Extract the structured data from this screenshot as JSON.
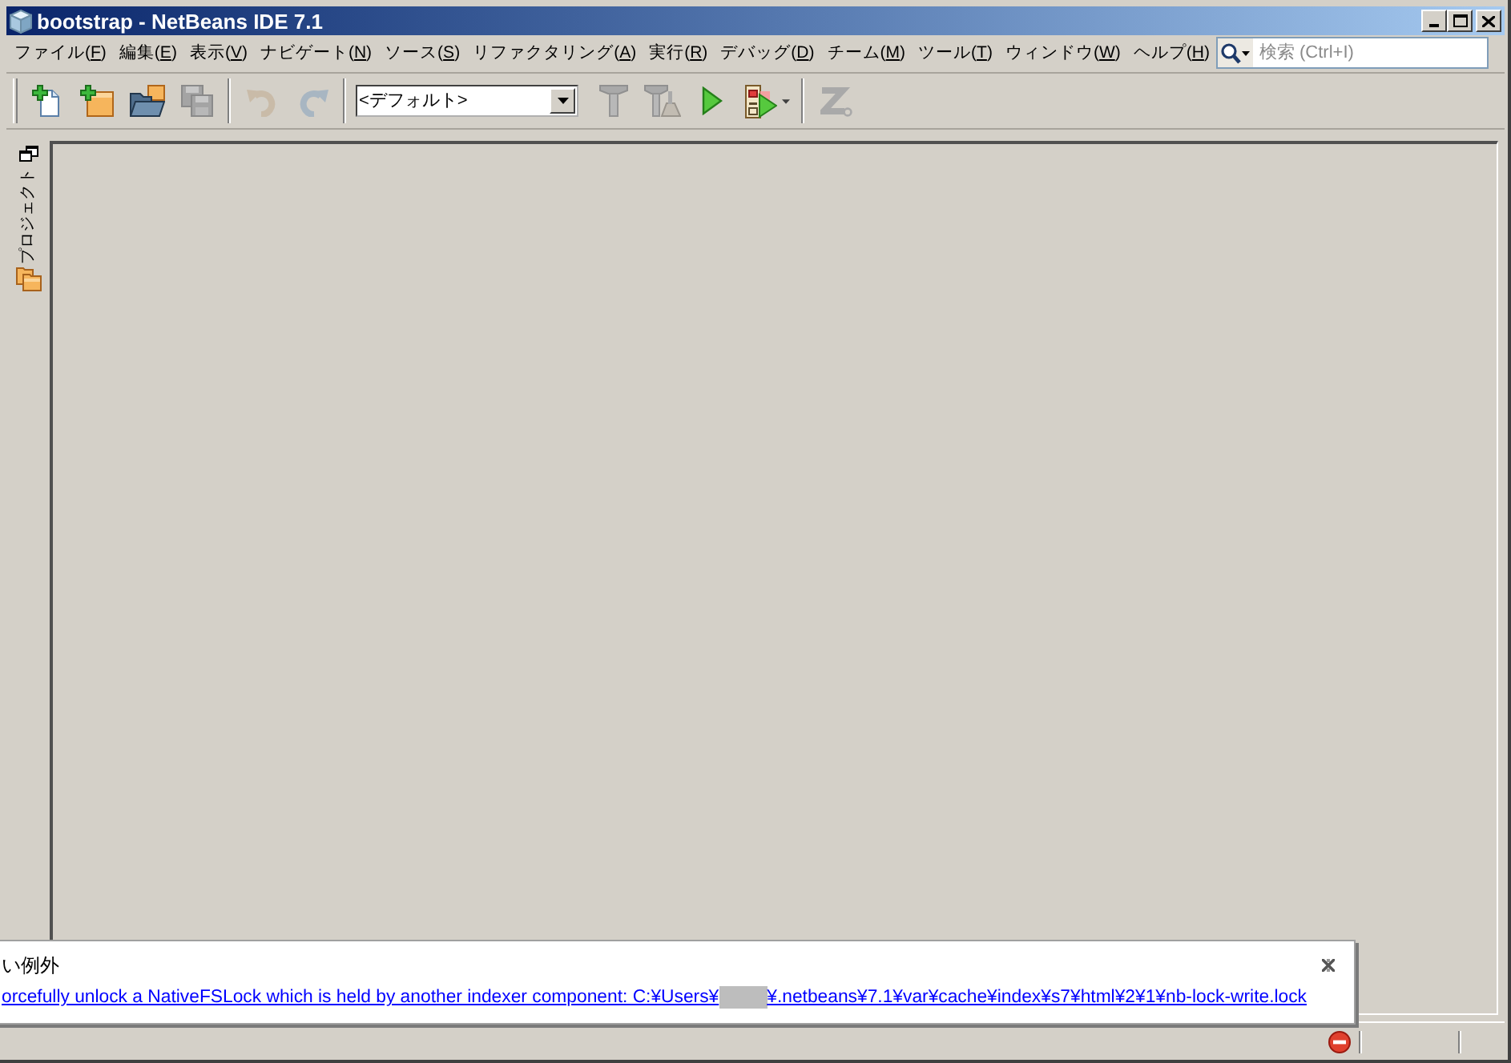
{
  "window": {
    "title": "bootstrap - NetBeans IDE 7.1"
  },
  "menu": [
    {
      "label": "ファイル(F)"
    },
    {
      "label": "編集(E)"
    },
    {
      "label": "表示(V)"
    },
    {
      "label": "ナビゲート(N)"
    },
    {
      "label": "ソース(S)"
    },
    {
      "label": "リファクタリング(A)"
    },
    {
      "label": "実行(R)"
    },
    {
      "label": "デバッグ(D)"
    },
    {
      "label": "チーム(M)"
    },
    {
      "label": "ツール(T)"
    },
    {
      "label": "ウィンドウ(W)"
    },
    {
      "label": "ヘルプ(H)"
    }
  ],
  "search": {
    "placeholder": "検索 (Ctrl+I)"
  },
  "toolbar": [
    {
      "kind": "button",
      "disabled": false
    },
    {
      "kind": "button",
      "disabled": false
    },
    {
      "kind": "button",
      "disabled": false
    },
    {
      "kind": "button",
      "disabled": true
    },
    {
      "kind": "separator"
    },
    {
      "kind": "button",
      "disabled": true
    },
    {
      "kind": "button",
      "disabled": true
    },
    {
      "kind": "separator"
    },
    {
      "kind": "combo",
      "value": "<デフォルト>"
    },
    {
      "kind": "button",
      "disabled": true
    },
    {
      "kind": "button",
      "disabled": true
    },
    {
      "kind": "button",
      "disabled": false
    },
    {
      "kind": "split_button",
      "disabled": false
    },
    {
      "kind": "separator"
    },
    {
      "kind": "button",
      "disabled": true
    }
  ],
  "side_panel": {
    "tabs": [
      {
        "label": "プロジェクト"
      }
    ]
  },
  "notification": {
    "title": "い例外",
    "link_start": "orcefully unlock a NativeFSLock which is held by another indexer component: C:¥Users¥",
    "link_end": "¥.netbeans¥7.1¥var¥cache¥index¥s7¥html¥2¥1¥nb-lock-write.lock"
  },
  "status_bar": {
    "error": true
  }
}
